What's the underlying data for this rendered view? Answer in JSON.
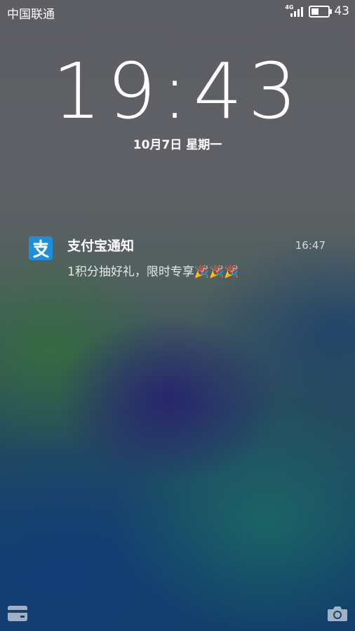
{
  "status_bar": {
    "carrier": "中国联通",
    "network_type": "4G",
    "battery_level": 43,
    "battery_text": "43"
  },
  "lock_screen": {
    "time": "19:43",
    "date": "10月7日  星期一"
  },
  "notification": {
    "app_icon": "alipay-icon",
    "app_name": "支付宝通知",
    "time": "16:47",
    "body": "1积分抽好礼，限时专享🎉🎉🎉"
  },
  "shortcuts": {
    "left_icon": "wallet-icon",
    "right_icon": "camera-icon"
  },
  "colors": {
    "alipay_blue": "#1e8ed8"
  }
}
